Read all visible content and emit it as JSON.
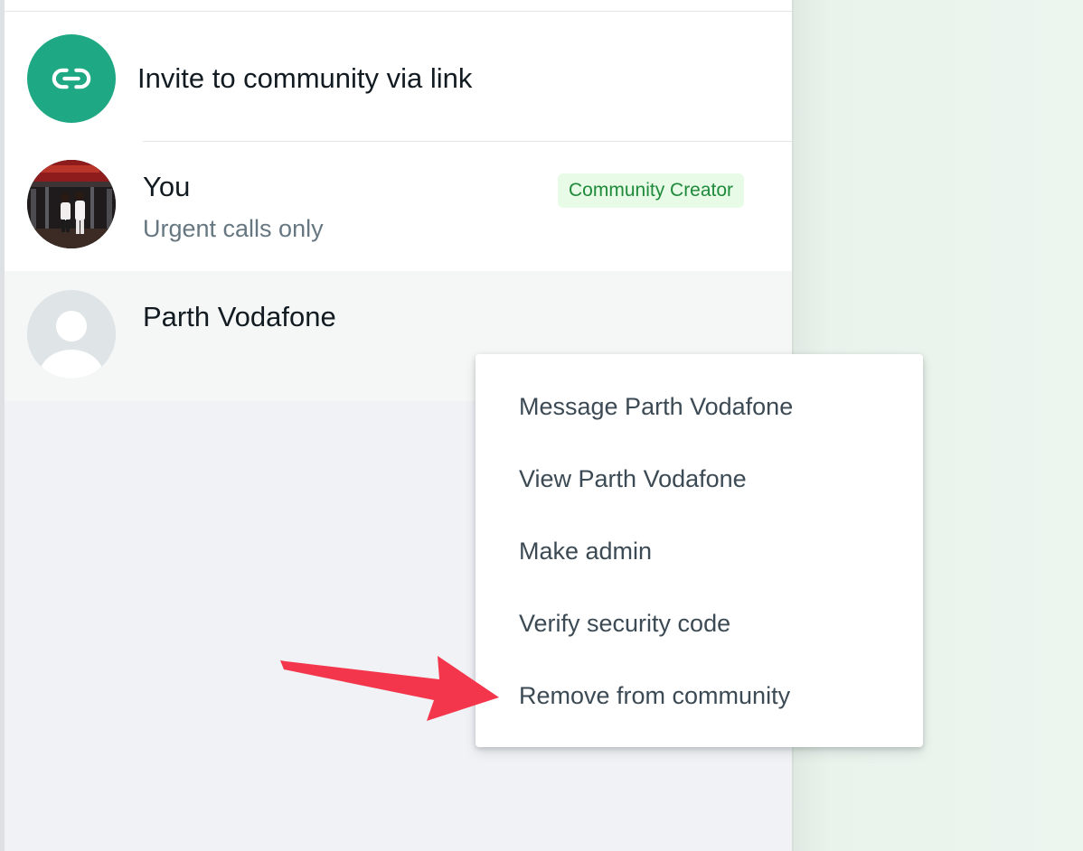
{
  "invite": {
    "label": "Invite to community via link",
    "icon": "link-icon",
    "avatar_color": "#1ea883"
  },
  "members": [
    {
      "name": "You",
      "status": "Urgent calls only",
      "badge": "Community Creator"
    },
    {
      "name": "Parth Vodafone"
    }
  ],
  "context_menu": {
    "items": [
      "Message Parth Vodafone",
      "View Parth Vodafone",
      "Make admin",
      "Verify security code",
      "Remove from community"
    ]
  },
  "colors": {
    "accent_green": "#1ea883",
    "badge_bg": "#e7fbe6",
    "badge_text": "#1f8a3b",
    "annotation_arrow": "#f4364c"
  }
}
